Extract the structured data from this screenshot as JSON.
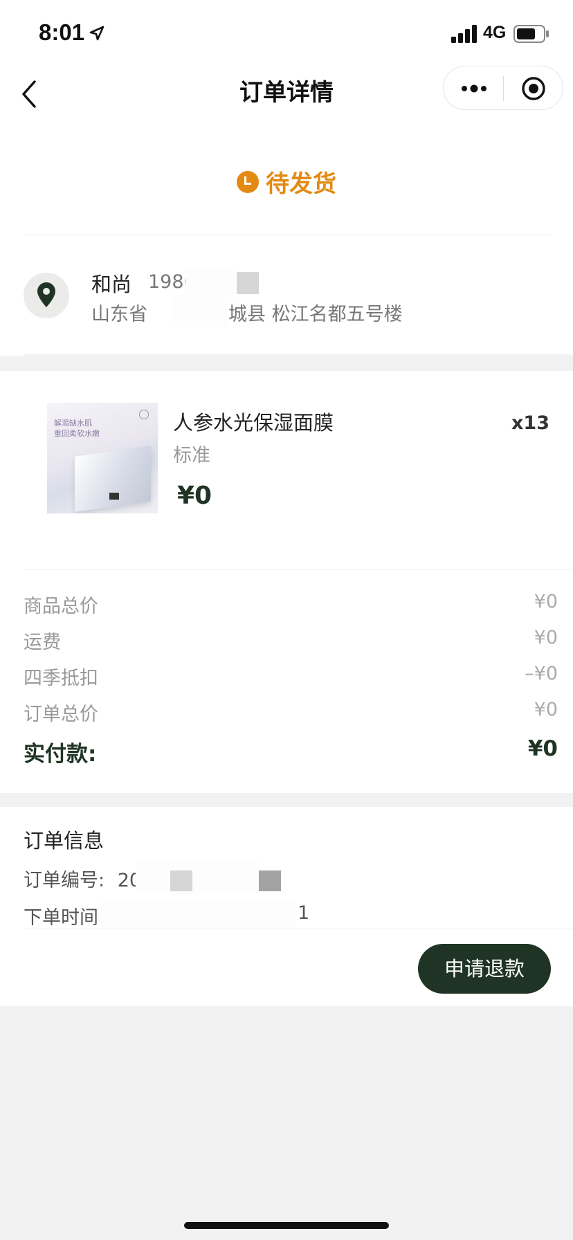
{
  "status_bar": {
    "time": "8:01",
    "network": "4G",
    "icons": [
      "location-arrow-icon",
      "signal-icon",
      "battery-icon"
    ]
  },
  "nav": {
    "title": "订单详情",
    "back_icon": "chevron-left-icon",
    "more_icon": "more-dots-icon",
    "close_icon": "target-icon"
  },
  "order_status": {
    "icon": "clock-icon",
    "text": "待发货",
    "color": "#e38a12"
  },
  "address": {
    "icon": "location-pin-icon",
    "name": "和尚",
    "phone": "1986",
    "line_start": "山东省",
    "line_end": "城县 松江名都五号楼"
  },
  "product": {
    "image_text_1": "解渴缺水肌",
    "image_text_2": "重回柔软水嫩",
    "name": "人参水光保湿面膜",
    "spec": "标准",
    "price": "¥0",
    "quantity": "x13"
  },
  "summary": {
    "rows": [
      {
        "label": "商品总价",
        "value": "¥0"
      },
      {
        "label": "运费",
        "value": "¥0"
      },
      {
        "label": "四季抵扣",
        "value": "–¥0"
      },
      {
        "label": "订单总价",
        "value": "¥0"
      }
    ],
    "paid_label": "实付款:",
    "paid_value": "¥0"
  },
  "order_info": {
    "title": "订单信息",
    "number_label": "订单编号:",
    "number_value": "20",
    "time_label": "下单时间",
    "time_value": "1"
  },
  "actions": {
    "refund_label": "申请退款"
  },
  "colors": {
    "accent": "#1f3424",
    "status": "#e38a12",
    "background": "#f2f2f2"
  }
}
